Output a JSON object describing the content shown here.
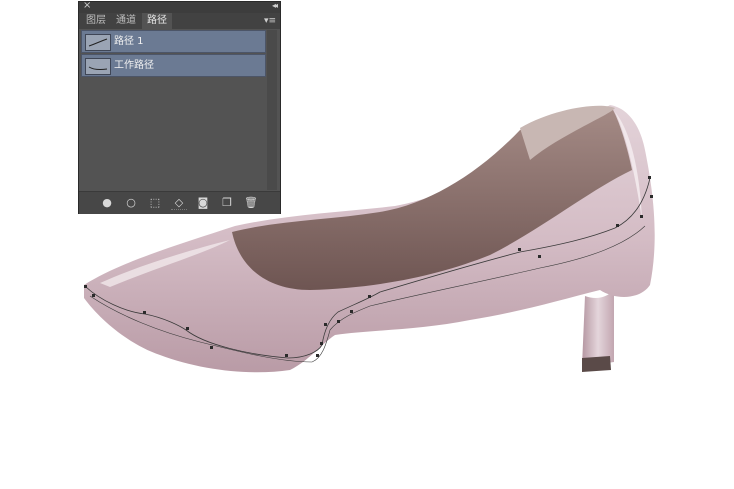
{
  "panel": {
    "close_glyph": "×",
    "collapse_glyph": "◂◂",
    "menu_glyph": "▾≡",
    "tabs": [
      {
        "label": "图层",
        "active": false
      },
      {
        "label": "通道",
        "active": false
      },
      {
        "label": "路径",
        "active": true
      }
    ],
    "paths": [
      {
        "label": "路径 1",
        "selected": true
      },
      {
        "label": "工作路径",
        "selected": true
      }
    ],
    "tools": [
      {
        "icon": "fill-path-icon",
        "glyph": "●"
      },
      {
        "icon": "stroke-path-icon",
        "glyph": "○"
      },
      {
        "icon": "load-selection-icon",
        "glyph": "⬚"
      },
      {
        "icon": "make-work-path-icon",
        "glyph": "◇"
      },
      {
        "icon": "add-mask-icon",
        "glyph": "◙"
      },
      {
        "icon": "new-path-icon",
        "glyph": "❐"
      },
      {
        "icon": "delete-path-icon",
        "glyph": "🗑"
      }
    ]
  },
  "colors": {
    "shoe_body": "#d8c3cb",
    "shoe_highlight": "#eadde2",
    "shoe_shadow": "#b99ba6",
    "lining": "#8a6f6b",
    "heel_tip": "#5a4a48",
    "path_line": "#3a3a3a"
  }
}
